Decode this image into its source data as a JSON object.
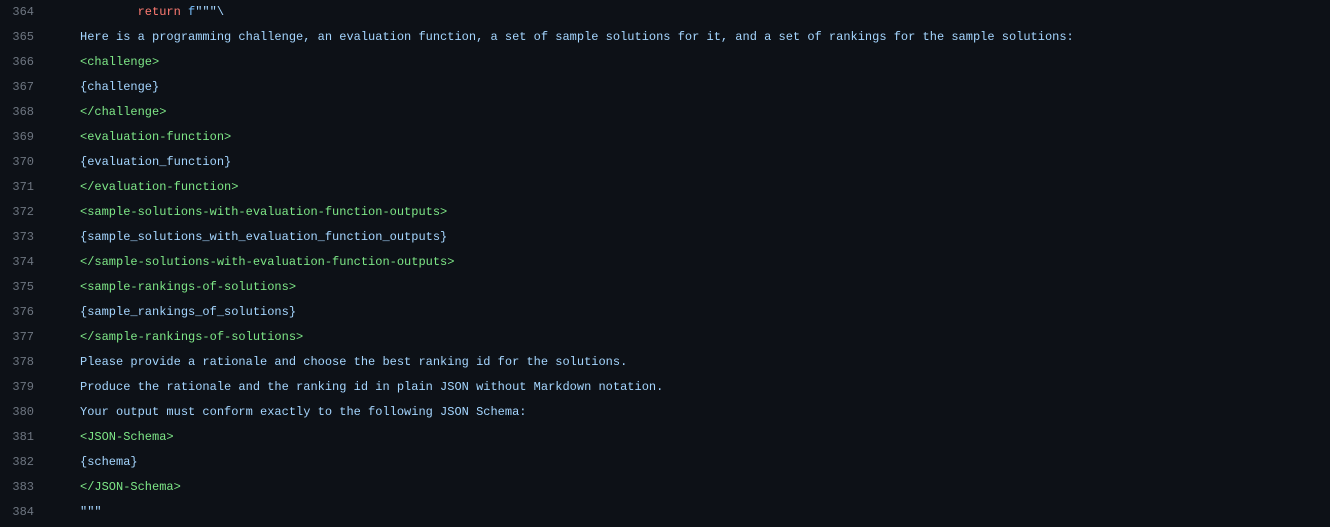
{
  "lines": [
    {
      "num": "364",
      "segments": [
        {
          "text": "        ",
          "cls": ""
        },
        {
          "text": "return",
          "cls": "keyword"
        },
        {
          "text": " ",
          "cls": ""
        },
        {
          "text": "f",
          "cls": "fstring-prefix"
        },
        {
          "text": "\"\"\"\\",
          "cls": "string"
        }
      ]
    },
    {
      "num": "365",
      "segments": [
        {
          "text": "Here is a programming challenge, an evaluation function, a set of sample solutions for it, and a set of rankings for the sample solutions:",
          "cls": "text-content"
        }
      ]
    },
    {
      "num": "366",
      "segments": [
        {
          "text": "<challenge>",
          "cls": "tag"
        }
      ]
    },
    {
      "num": "367",
      "segments": [
        {
          "text": "{challenge}",
          "cls": "interpolation"
        }
      ]
    },
    {
      "num": "368",
      "segments": [
        {
          "text": "</challenge>",
          "cls": "tag"
        }
      ]
    },
    {
      "num": "369",
      "segments": [
        {
          "text": "<evaluation-function>",
          "cls": "tag"
        }
      ]
    },
    {
      "num": "370",
      "segments": [
        {
          "text": "{evaluation_function}",
          "cls": "interpolation"
        }
      ]
    },
    {
      "num": "371",
      "segments": [
        {
          "text": "</evaluation-function>",
          "cls": "tag"
        }
      ]
    },
    {
      "num": "372",
      "segments": [
        {
          "text": "<sample-solutions-with-evaluation-function-outputs>",
          "cls": "tag"
        }
      ]
    },
    {
      "num": "373",
      "segments": [
        {
          "text": "{sample_solutions_with_evaluation_function_outputs}",
          "cls": "interpolation"
        }
      ]
    },
    {
      "num": "374",
      "segments": [
        {
          "text": "</sample-solutions-with-evaluation-function-outputs>",
          "cls": "tag"
        }
      ]
    },
    {
      "num": "375",
      "segments": [
        {
          "text": "<sample-rankings-of-solutions>",
          "cls": "tag"
        }
      ]
    },
    {
      "num": "376",
      "segments": [
        {
          "text": "{sample_rankings_of_solutions}",
          "cls": "interpolation"
        }
      ]
    },
    {
      "num": "377",
      "segments": [
        {
          "text": "</sample-rankings-of-solutions>",
          "cls": "tag"
        }
      ]
    },
    {
      "num": "378",
      "segments": [
        {
          "text": "Please provide a rationale and choose the best ranking id for the solutions.",
          "cls": "text-content"
        }
      ]
    },
    {
      "num": "379",
      "segments": [
        {
          "text": "Produce the rationale and the ranking id in plain JSON without Markdown notation.",
          "cls": "text-content"
        }
      ]
    },
    {
      "num": "380",
      "segments": [
        {
          "text": "Your output must conform exactly to the following JSON Schema:",
          "cls": "text-content"
        }
      ]
    },
    {
      "num": "381",
      "segments": [
        {
          "text": "<JSON-Schema>",
          "cls": "tag"
        }
      ]
    },
    {
      "num": "382",
      "segments": [
        {
          "text": "{schema}",
          "cls": "interpolation"
        }
      ]
    },
    {
      "num": "383",
      "segments": [
        {
          "text": "</JSON-Schema>",
          "cls": "tag"
        }
      ]
    },
    {
      "num": "384",
      "segments": [
        {
          "text": "\"\"\"",
          "cls": "string"
        }
      ]
    }
  ]
}
